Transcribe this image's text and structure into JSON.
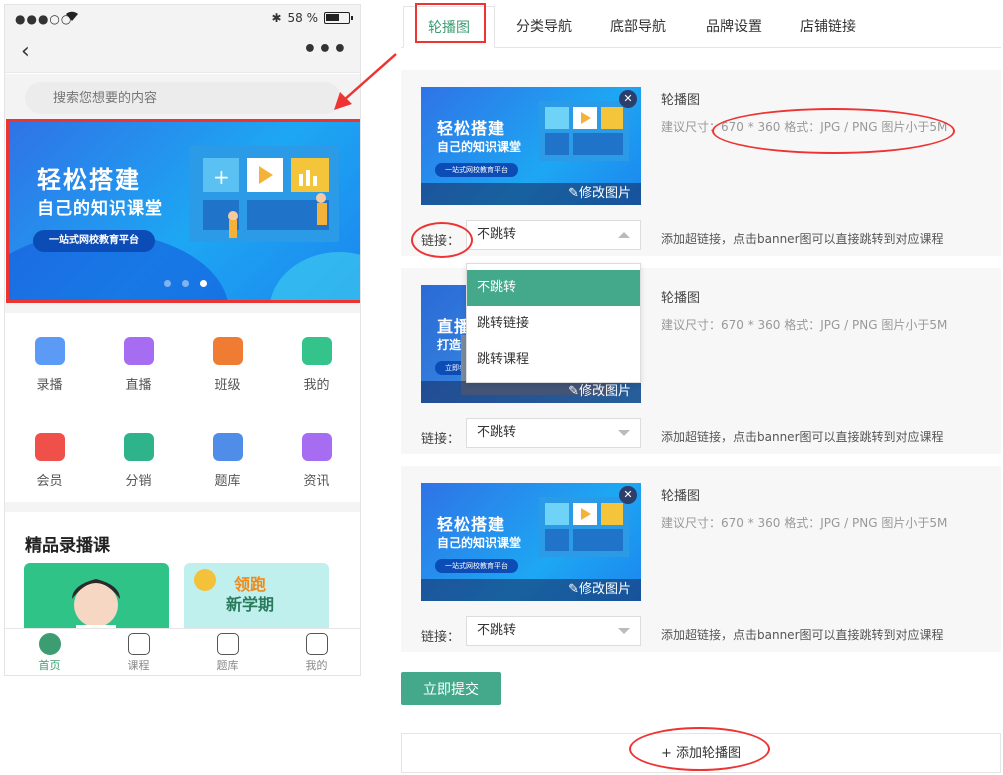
{
  "phone": {
    "status": {
      "carrier": "●●●○○",
      "battery_pct": "58 %"
    },
    "nav": {
      "back": "‹",
      "more": "•••"
    },
    "search": {
      "placeholder": "搜索您想要的内容"
    },
    "banner": {
      "title1": "轻松搭建",
      "title2": "自己的知识课堂",
      "pill": "一站式网校教育平台",
      "dots": 3,
      "active_dot": 3
    },
    "grid": [
      {
        "label": "录播",
        "icon": "video-icon",
        "color": "#5b9bf5"
      },
      {
        "label": "直播",
        "icon": "tv-icon",
        "color": "#a66cf2"
      },
      {
        "label": "班级",
        "icon": "planet-icon",
        "color": "#f07c34"
      },
      {
        "label": "我的",
        "icon": "bear-icon",
        "color": "#33c38b"
      },
      {
        "label": "会员",
        "icon": "diamond-icon",
        "color": "#f0504a"
      },
      {
        "label": "分销",
        "icon": "tag-icon",
        "color": "#2eb38b"
      },
      {
        "label": "题库",
        "icon": "book-icon",
        "color": "#4f8de8"
      },
      {
        "label": "资讯",
        "icon": "news-icon",
        "color": "#a66cf2"
      }
    ],
    "section_title": "精品录播课",
    "course2_title1": "领跑",
    "course2_title2": "新学期",
    "tabbar": [
      {
        "label": "首页",
        "icon": "home-icon",
        "active": true
      },
      {
        "label": "课程",
        "icon": "course-icon",
        "active": false
      },
      {
        "label": "题库",
        "icon": "quiz-icon",
        "active": false
      },
      {
        "label": "我的",
        "icon": "profile-icon",
        "active": false
      }
    ]
  },
  "tabs": [
    {
      "label": "轮播图",
      "active": true
    },
    {
      "label": "分类导航",
      "active": false
    },
    {
      "label": "底部导航",
      "active": false
    },
    {
      "label": "品牌设置",
      "active": false
    },
    {
      "label": "店铺链接",
      "active": false
    }
  ],
  "cards": [
    {
      "title": "轮播图",
      "desc": "建议尺寸：670 * 360 格式：JPG / PNG 图片小于5M",
      "edit_label": "修改图片",
      "link_label": "链接：",
      "select_value": "不跳转",
      "link_hint": "添加超链接，点击banner图可以直接跳转到对应课程",
      "thumb": {
        "t1": "轻松搭建",
        "t2": "自己的知识课堂",
        "t3": "一站式网校教育平台"
      }
    },
    {
      "title": "轮播图",
      "desc": "建议尺寸：670 * 360 格式：JPG / PNG 图片小于5M",
      "edit_label": "修改图片",
      "link_label": "链接：",
      "select_value": "不跳转",
      "link_hint": "添加超链接，点击banner图可以直接跳转到对应课程",
      "thumb": {
        "t1": "直播、",
        "t2": "打造",
        "t3": "立即参"
      }
    },
    {
      "title": "轮播图",
      "desc": "建议尺寸：670 * 360 格式：JPG / PNG 图片小于5M",
      "edit_label": "修改图片",
      "link_label": "链接：",
      "select_value": "不跳转",
      "link_hint": "添加超链接，点击banner图可以直接跳转到对应课程",
      "thumb": {
        "t1": "轻松搭建",
        "t2": "自己的知识课堂",
        "t3": "一站式网校教育平台"
      }
    }
  ],
  "dropdown": {
    "options": [
      "不跳转",
      "跳转链接",
      "跳转课程"
    ],
    "selected": 0
  },
  "submit_label": "立即提交",
  "add_label": "+ 添加轮播图",
  "colors": {
    "accent": "#44a98a",
    "annotation": "#e33333"
  }
}
